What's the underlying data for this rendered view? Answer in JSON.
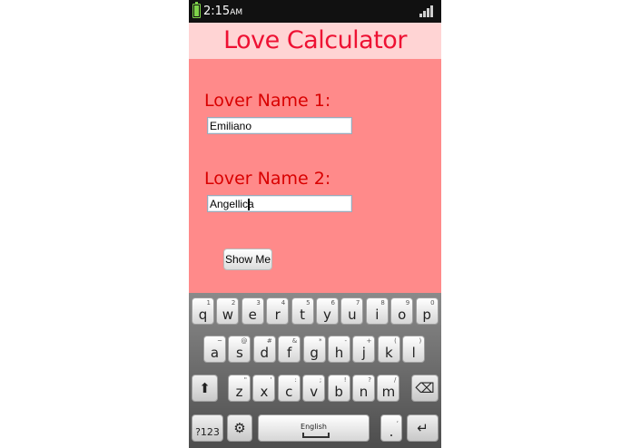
{
  "status_bar": {
    "time": "2:15",
    "ampm": "AM"
  },
  "app": {
    "title": "Love Calculator",
    "lover1": {
      "label": "Lover Name 1:",
      "value": "Emiliano"
    },
    "lover2": {
      "label": "Lover Name 2:",
      "value": "Angellica"
    },
    "button_label": "Show Me"
  },
  "keyboard": {
    "row1": [
      {
        "key": "q",
        "hint": "1"
      },
      {
        "key": "w",
        "hint": "2"
      },
      {
        "key": "e",
        "hint": "3"
      },
      {
        "key": "r",
        "hint": "4"
      },
      {
        "key": "t",
        "hint": "5"
      },
      {
        "key": "y",
        "hint": "6"
      },
      {
        "key": "u",
        "hint": "7"
      },
      {
        "key": "i",
        "hint": "8"
      },
      {
        "key": "o",
        "hint": "9"
      },
      {
        "key": "p",
        "hint": "0"
      }
    ],
    "row2": [
      {
        "key": "a",
        "hint": "~"
      },
      {
        "key": "s",
        "hint": "@"
      },
      {
        "key": "d",
        "hint": "#"
      },
      {
        "key": "f",
        "hint": "&"
      },
      {
        "key": "g",
        "hint": "*"
      },
      {
        "key": "h",
        "hint": "-"
      },
      {
        "key": "j",
        "hint": "+"
      },
      {
        "key": "k",
        "hint": "("
      },
      {
        "key": "l",
        "hint": ")"
      }
    ],
    "row3": [
      {
        "key": "z",
        "hint": "\""
      },
      {
        "key": "x",
        "hint": "'"
      },
      {
        "key": "c",
        "hint": ":"
      },
      {
        "key": "v",
        "hint": ";"
      },
      {
        "key": "b",
        "hint": "!"
      },
      {
        "key": "n",
        "hint": "?"
      },
      {
        "key": "m",
        "hint": "/"
      }
    ],
    "sym_label": "?123",
    "space_label": "English",
    "period_label": ".",
    "period_hint": ","
  }
}
